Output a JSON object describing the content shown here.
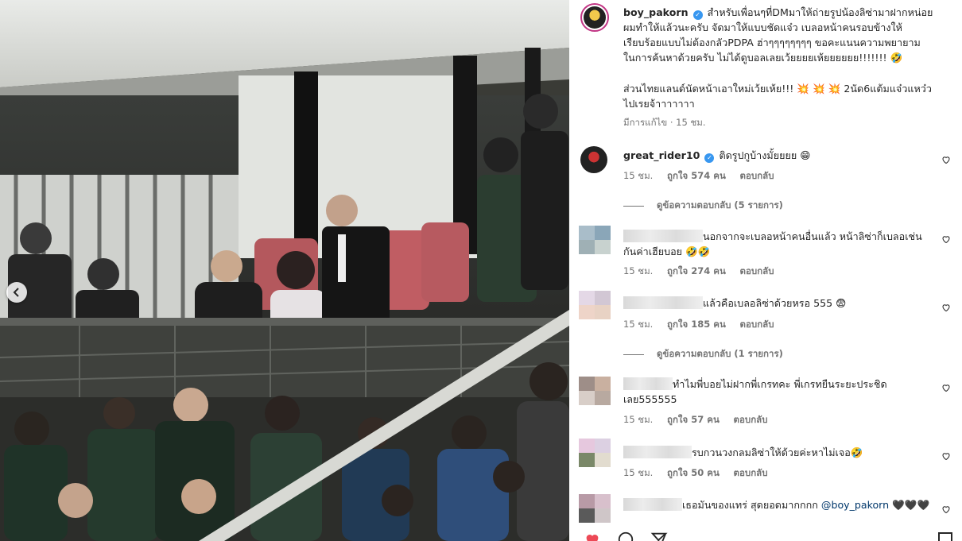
{
  "post": {
    "username": "boy_pakorn",
    "caption": "สำหรับเพื่อนๆที่DMมาให้ถ่ายรูปน้องลิซ่ามาฝากหน่อยผมทำให้แล้วนะครับ จัดมาให้แบบชัดแจ๋ว เบลอหน้าคนรอบข้างให้เรียบร้อยแบบไม่ต้องกลัวPDPA ฮ่าๆๆๆๆๆๆๆๆ ขอคะแนนความพยายามในการค้นหาด้วยครับ ไม่ได้ดูบอลเลยเว้ยยยยเห้ยยยยยย!!!!!!! 🤣",
    "caption_lines": [
      "สำหรับเพื่อนๆที่DMมาให้ถ่ายรูปน้องลิซ่ามาฝากหน่อย",
      "ผมทำให้แล้วนะครับ จัดมาให้แบบชัดแจ๋ว เบลอหน้าคนรอบข้างให้",
      "เรียบร้อยแบบไม่ต้องกลัวPDPA ฮ่าๆๆๆๆๆๆๆๆ ขอคะแนนความพยายาม",
      "ในการค้นหาด้วยครับ ไม่ได้ดูบอลเลยเว้ยยยยเห้ยยยยยย!!!!!!! 🤣"
    ],
    "caption2_lines": [
      "ส่วนไทยแลนด์นัดหน้าเอาใหม่เว้ยเห้ย!!! 💥 💥 💥 2นัด6แต้มแจ๋วแหว๋ว",
      "ไปเรยจ้าาาาาาา"
    ],
    "edited": "มีการแก้ไข · 15 ชม."
  },
  "comments": [
    {
      "username": "great_rider10",
      "verified": true,
      "text": "ติดรูปกูบ้างมั้ยยยย 😁",
      "time": "15 ชม.",
      "likes": "ถูกใจ 574 คน",
      "reply": "ตอบกลับ",
      "view_replies": "ดูข้อความตอบกลับ (5 รายการ)"
    },
    {
      "username": "",
      "text_lines": [
        "นอกจากจะเบลอหน้าคนอื่นแล้ว หน้าลิซ่าก็เบลอเช่น",
        "กันค่าเฮียบอย 🤣🤣"
      ],
      "time": "15 ชม.",
      "likes": "ถูกใจ 274 คน",
      "reply": "ตอบกลับ"
    },
    {
      "username": "",
      "text": "แล้วคือเบลอลิซ่าด้วยหรอ 555 😨",
      "time": "15 ชม.",
      "likes": "ถูกใจ 185 คน",
      "reply": "ตอบกลับ",
      "view_replies": "ดูข้อความตอบกลับ (1 รายการ)"
    },
    {
      "username": "",
      "text_lines": [
        "ทำไมพี่บอยไม่ฝากพี่เกรทคะ พี่เกรทยืนระยะประชิด",
        "เลย555555"
      ],
      "time": "15 ชม.",
      "likes": "ถูกใจ 57 คน",
      "reply": "ตอบกลับ"
    },
    {
      "username": "",
      "text": "รบกวนวงกลมลิซ่าให้ด้วยค่ะหาไม่เจอ🤣",
      "time": "15 ชม.",
      "likes": "ถูกใจ 50 คน",
      "reply": "ตอบกลับ"
    },
    {
      "username": "",
      "text": "เธอมันของแทร่ สุดยอดมากกกก",
      "mention": "@boy_pakorn",
      "hearts": "🖤🖤🖤"
    }
  ],
  "icons": [
    "chevron-left-icon",
    "verified-badge-icon",
    "heart-icon",
    "comment-icon",
    "share-icon",
    "bookmark-icon"
  ],
  "colors": {
    "verified": "#3897f0",
    "muted": "#737373",
    "text": "#262626",
    "mention": "#00376b",
    "like": "#ed4956"
  }
}
